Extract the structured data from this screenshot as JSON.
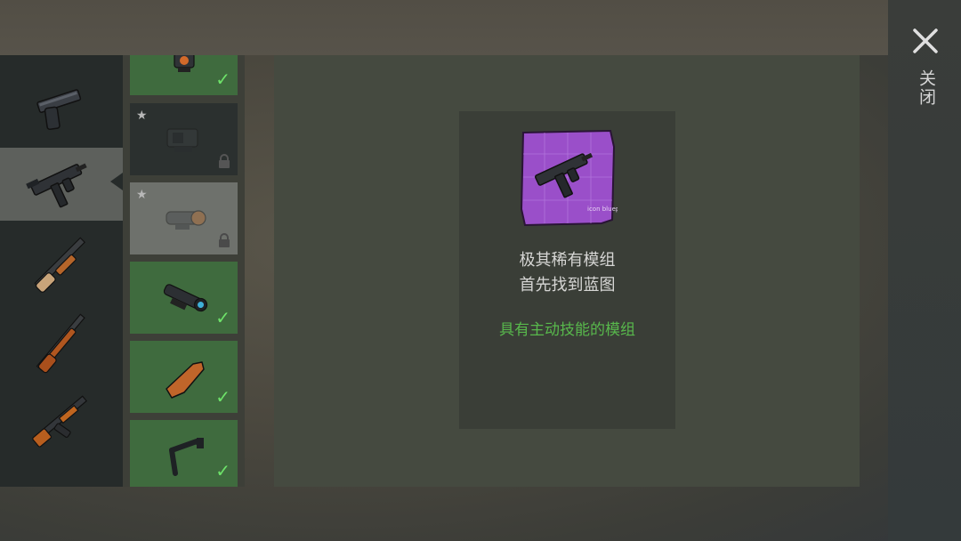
{
  "header": {
    "close_label": "关闭"
  },
  "weapons": [
    {
      "name": "pistol-icon",
      "selected": false
    },
    {
      "name": "smg-icon",
      "selected": true
    },
    {
      "name": "shotgun-icon",
      "selected": false
    },
    {
      "name": "rifle-icon",
      "selected": false
    },
    {
      "name": "ak-icon",
      "selected": false
    }
  ],
  "mods": [
    {
      "name": "red-dot-sight-icon",
      "state": "owned"
    },
    {
      "name": "holo-sight-icon",
      "state": "locked"
    },
    {
      "name": "scope-icon",
      "state": "locked"
    },
    {
      "name": "acog-scope-icon",
      "state": "owned"
    },
    {
      "name": "wooden-stock-icon",
      "state": "owned"
    },
    {
      "name": "folding-stock-icon",
      "state": "owned"
    }
  ],
  "details": {
    "icon": "smg-blueprint-icon",
    "blueprint_caption": "icon blueprint",
    "rarity_line1": "极其稀有模组",
    "rarity_line2": "首先找到蓝图",
    "skill_text": "具有主动技能的模组"
  },
  "colors": {
    "owned_tile": "#3f6b3e",
    "check": "#6ee36a",
    "skill_text": "#58b84c",
    "blueprint": "#9a4fc9"
  }
}
